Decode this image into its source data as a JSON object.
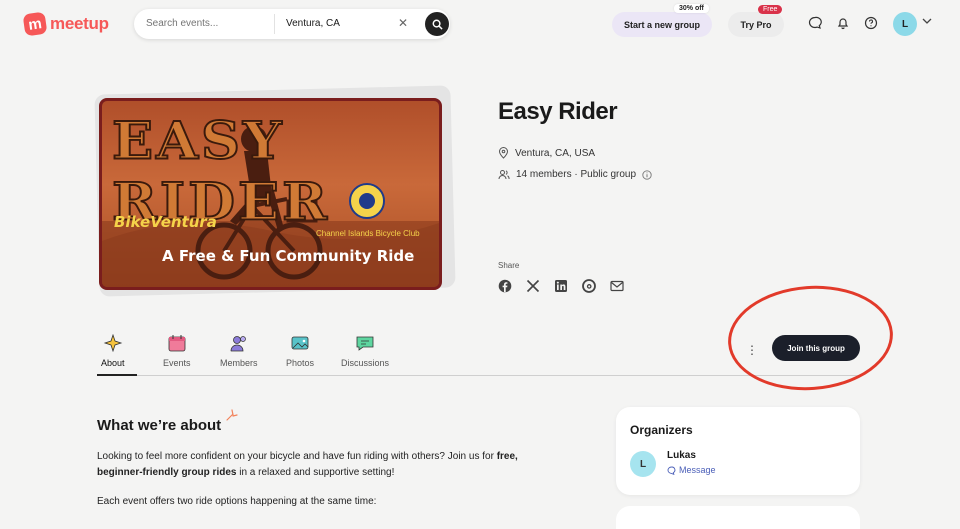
{
  "header": {
    "logo_text": "meetup",
    "search_placeholder": "Search events...",
    "location_value": "Ventura, CA",
    "start_group_label": "Start a new group",
    "promo_label": "30% off",
    "try_pro_label": "Try Pro",
    "free_label": "Free",
    "avatar_initial": "L"
  },
  "hero": {
    "title": "EASY RIDER",
    "brand": "BikeVentura",
    "tagline": "A Free & Fun Community Ride",
    "club": "Channel Islands Bicycle Club"
  },
  "group": {
    "name": "Easy Rider",
    "location": "Ventura, CA, USA",
    "members_text": "14 members · Public group",
    "share_label": "Share"
  },
  "tabs": [
    {
      "label": "About",
      "color": "#f6c33d"
    },
    {
      "label": "Events",
      "color": "#f07b9a"
    },
    {
      "label": "Members",
      "color": "#8b7bd9"
    },
    {
      "label": "Photos",
      "color": "#58c3c9"
    },
    {
      "label": "Discussions",
      "color": "#5ed6a0"
    }
  ],
  "join_label": "Join this group",
  "about": {
    "heading": "What we’re about",
    "p1_a": "Looking to feel more confident on your bicycle and have fun riding with others? Join us for ",
    "p1_b": "free, beginner-friendly group rides",
    "p1_c": " in a relaxed and supportive setting!",
    "p2": "Each event offers two ride options happening at the same time:"
  },
  "organizers": {
    "heading": "Organizers",
    "name": "Lukas",
    "initial": "L",
    "message_label": "Message"
  }
}
